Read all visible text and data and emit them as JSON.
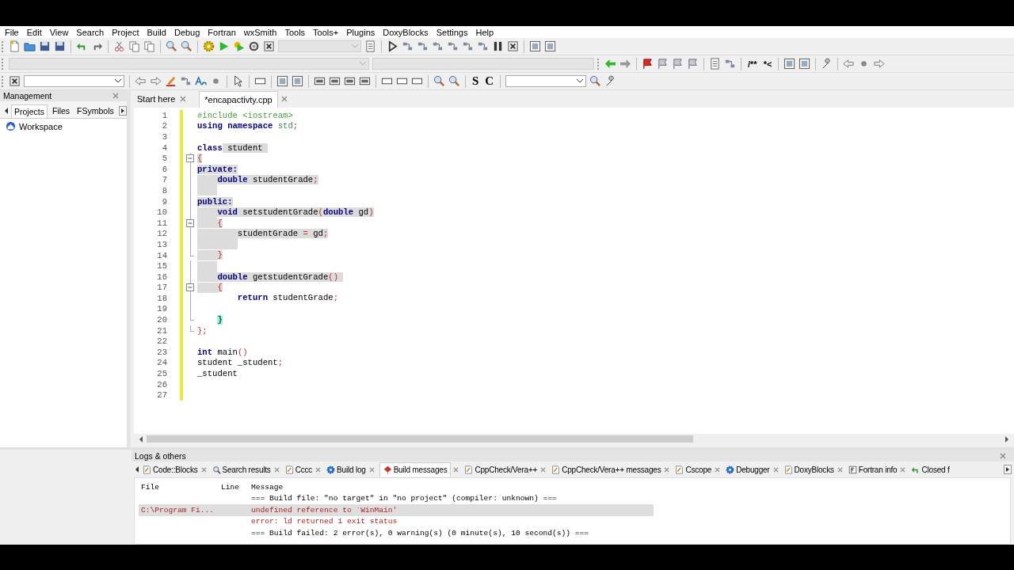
{
  "menu": [
    "File",
    "Edit",
    "View",
    "Search",
    "Project",
    "Build",
    "Debug",
    "Fortran",
    "wxSmith",
    "Tools",
    "Tools+",
    "Plugins",
    "DoxyBlocks",
    "Settings",
    "Help"
  ],
  "toolbar_texts": {
    "doc_comment": "/**",
    "line_comment": "*<",
    "bold_s": "S",
    "bold_c": "C"
  },
  "management": {
    "title": "Management",
    "tabs": [
      {
        "label": "Projects",
        "selected": true
      },
      {
        "label": "Files",
        "selected": false
      },
      {
        "label": "FSymbols",
        "selected": false
      }
    ],
    "tree": [
      {
        "label": "Workspace"
      }
    ]
  },
  "editor": {
    "tabs": [
      {
        "label": "Start here",
        "selected": false
      },
      {
        "label": "*encapactivty.cpp",
        "selected": true
      }
    ],
    "lines": [
      {
        "number": "1",
        "tokens": [
          {
            "text": "#include <iostream>",
            "kind": "pre",
            "selected": false
          }
        ]
      },
      {
        "number": "2",
        "tokens": [
          {
            "text": "using",
            "kind": "kw",
            "selected": false
          },
          {
            "text": " namespace",
            "kind": "kw",
            "selected": false
          },
          {
            "text": " std",
            "kind": "ns",
            "selected": false
          },
          {
            "text": ";",
            "kind": "op",
            "selected": false
          }
        ]
      },
      {
        "number": "3"
      },
      {
        "number": "4",
        "tokens": [
          {
            "text": "class",
            "kind": "kw",
            "selected": false
          },
          {
            "text": " student ",
            "kind": "plain",
            "selected": true
          }
        ]
      },
      {
        "number": "5",
        "fold_start": true,
        "tokens": [
          {
            "text": "{",
            "kind": "op",
            "selected": true
          }
        ]
      },
      {
        "number": "6",
        "tokens": [
          {
            "text": "private:",
            "kind": "kw",
            "selected": true
          }
        ]
      },
      {
        "number": "7",
        "tokens": [
          {
            "kind": "tab",
            "selected": true
          },
          {
            "text": "double",
            "kind": "kw",
            "selected": true
          },
          {
            "text": " studentGrade",
            "kind": "plain",
            "selected": true
          },
          {
            "text": ";",
            "kind": "op",
            "selected": true
          }
        ]
      },
      {
        "number": "8",
        "tokens": [
          {
            "kind": "tab",
            "selected": true
          }
        ]
      },
      {
        "number": "9",
        "tokens": [
          {
            "text": "public:",
            "kind": "kw",
            "selected": true
          }
        ]
      },
      {
        "number": "10",
        "tokens": [
          {
            "kind": "tab",
            "selected": true
          },
          {
            "text": "void",
            "kind": "kw",
            "selected": true
          },
          {
            "text": " setstudentGrade",
            "kind": "plain",
            "selected": true
          },
          {
            "text": "(",
            "kind": "op",
            "selected": true
          },
          {
            "text": "double",
            "kind": "kw",
            "selected": true
          },
          {
            "text": " gd",
            "kind": "plain",
            "selected": true
          },
          {
            "text": ")",
            "kind": "op",
            "selected": true
          }
        ]
      },
      {
        "number": "11",
        "fold_start": true,
        "tokens": [
          {
            "kind": "tab",
            "selected": true
          },
          {
            "text": "{",
            "kind": "op",
            "selected": true
          }
        ]
      },
      {
        "number": "12",
        "tokens": [
          {
            "kind": "tab",
            "selected": true
          },
          {
            "kind": "tab",
            "selected": true
          },
          {
            "text": "studentGrade ",
            "kind": "plain",
            "selected": true
          },
          {
            "text": "=",
            "kind": "op",
            "selected": true
          },
          {
            "text": " gd",
            "kind": "plain",
            "selected": true
          },
          {
            "text": ";",
            "kind": "op",
            "selected": true
          }
        ]
      },
      {
        "number": "13",
        "tokens": [
          {
            "kind": "tab",
            "selected": true
          },
          {
            "kind": "tab",
            "selected": true
          }
        ]
      },
      {
        "number": "14",
        "fold_end": true,
        "tokens": [
          {
            "kind": "tab",
            "selected": true
          },
          {
            "text": "}",
            "kind": "op",
            "selected": true
          }
        ]
      },
      {
        "number": "15",
        "tokens": [
          {
            "kind": "tab",
            "selected": true
          }
        ]
      },
      {
        "number": "16",
        "tokens": [
          {
            "kind": "tab",
            "selected": true
          },
          {
            "text": "double",
            "kind": "kw",
            "selected": true
          },
          {
            "text": " getstudentGrade",
            "kind": "plain",
            "selected": true
          },
          {
            "text": "() ",
            "kind": "op",
            "selected": true
          }
        ]
      },
      {
        "number": "17",
        "fold_start": true,
        "tokens": [
          {
            "kind": "tab",
            "selected": true
          },
          {
            "text": "{",
            "kind": "op",
            "selected": true
          }
        ]
      },
      {
        "number": "18",
        "tokens": [
          {
            "kind": "tab",
            "selected": false
          },
          {
            "kind": "tab",
            "selected": false
          },
          {
            "text": "return",
            "kind": "kw",
            "selected": false
          },
          {
            "text": " studentGrade",
            "kind": "plain",
            "selected": false
          },
          {
            "text": ";",
            "kind": "op",
            "selected": false
          }
        ]
      },
      {
        "number": "19"
      },
      {
        "number": "20",
        "fold_end": true,
        "tokens": [
          {
            "kind": "tab",
            "selected": false
          },
          {
            "text": "}",
            "kind": "brace",
            "selected": false
          }
        ]
      },
      {
        "number": "21",
        "fold_end": true,
        "tokens": [
          {
            "text": "};",
            "kind": "op",
            "selected": false
          }
        ]
      },
      {
        "number": "22"
      },
      {
        "number": "23",
        "tokens": [
          {
            "text": "int",
            "kind": "kw",
            "selected": false
          },
          {
            "text": " main",
            "kind": "plain",
            "selected": false
          },
          {
            "text": "()",
            "kind": "op",
            "selected": false
          }
        ]
      },
      {
        "number": "24",
        "tokens": [
          {
            "text": "student _student",
            "kind": "plain",
            "selected": false
          },
          {
            "text": ";",
            "kind": "op",
            "selected": false
          }
        ]
      },
      {
        "number": "25",
        "tokens": [
          {
            "text": "_student",
            "kind": "plain",
            "selected": false
          }
        ]
      },
      {
        "number": "26"
      },
      {
        "number": "27"
      }
    ]
  },
  "logs": {
    "title": "Logs & others",
    "tabs": [
      {
        "label": "Code::Blocks",
        "kind": "doc",
        "selected": false
      },
      {
        "label": "Search results",
        "kind": "search",
        "selected": false
      },
      {
        "label": "Cccc",
        "kind": "doc",
        "selected": false
      },
      {
        "label": "Build log",
        "kind": "gear",
        "selected": false
      },
      {
        "label": "Build messages",
        "kind": "pin",
        "selected": true
      },
      {
        "label": "CppCheck/Vera++",
        "kind": "doc",
        "selected": false
      },
      {
        "label": "CppCheck/Vera++ messages",
        "kind": "doc",
        "selected": false
      },
      {
        "label": "Cscope",
        "kind": "doc",
        "selected": false
      },
      {
        "label": "Debugger",
        "kind": "gear",
        "selected": false
      },
      {
        "label": "DoxyBlocks",
        "kind": "doc",
        "selected": false
      },
      {
        "label": "Fortran info",
        "kind": "fortran",
        "selected": false
      },
      {
        "label": "Closed f",
        "kind": "closed",
        "selected": false
      }
    ],
    "columns": [
      "File",
      "Line",
      "Message"
    ],
    "rows": [
      {
        "kind": "info",
        "selected": false,
        "message": "=== Build file: \"no target\" in \"no project\" (compiler: unknown) ==="
      },
      {
        "kind": "error",
        "selected": true,
        "file": "C:\\Program Fi...",
        "message": "undefined reference to `WinMain'"
      },
      {
        "kind": "error",
        "selected": false,
        "message": "error: ld returned 1 exit status"
      },
      {
        "kind": "info",
        "selected": false,
        "message": "=== Build failed: 2 error(s), 0 warning(s) (0 minute(s), 10 second(s)) ==="
      }
    ]
  }
}
